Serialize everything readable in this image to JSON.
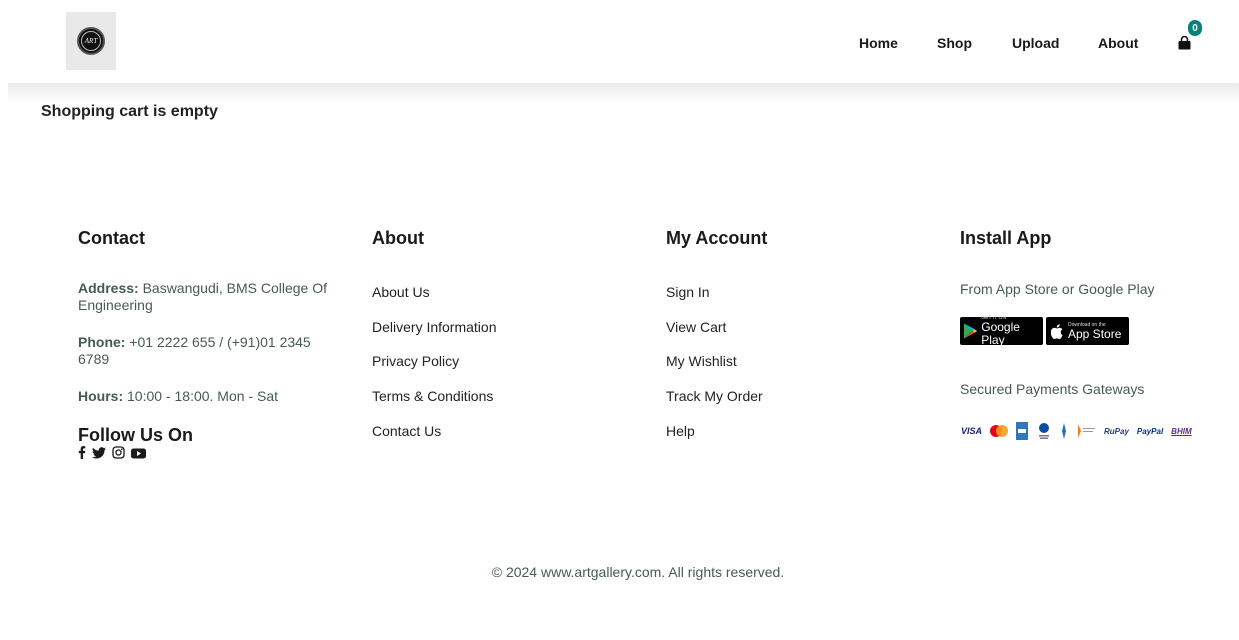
{
  "header": {
    "logo_text": "ART",
    "nav": [
      {
        "label": "Home"
      },
      {
        "label": "Shop"
      },
      {
        "label": "Upload"
      },
      {
        "label": "About"
      }
    ],
    "cart_count": "0"
  },
  "main": {
    "message": "Shopping cart is empty"
  },
  "footer": {
    "contact": {
      "title": "Contact",
      "address_label": "Address:",
      "address_value": " Baswangudi, BMS College Of Engineering",
      "phone_label": "Phone:",
      "phone_value": " +01 2222 655 / (+91)01 2345 6789",
      "hours_label": "Hours:",
      "hours_value": " 10:00 - 18:00. Mon - Sat",
      "follow_title": "Follow Us On",
      "socials": [
        "facebook-icon",
        "twitter-icon",
        "instagram-icon",
        "youtube-icon"
      ]
    },
    "about": {
      "title": "About",
      "links": [
        "About Us",
        "Delivery Information",
        "Privacy Policy",
        "Terms & Conditions",
        "Contact Us"
      ]
    },
    "account": {
      "title": "My Account",
      "links": [
        "Sign In",
        "View Cart",
        "My Wishlist",
        "Track My Order",
        "Help"
      ]
    },
    "app": {
      "title": "Install App",
      "subtitle": "From App Store or Google Play",
      "google_play_small": "GET IT ON",
      "google_play_big": "Google Play",
      "app_store_small": "Download on the",
      "app_store_big": "App Store",
      "payments_title": "Secured Payments Gateways",
      "payments": [
        "VISA",
        "Mastercard",
        "Amex",
        "Diners",
        "Net Banking",
        "UPI",
        "RuPay",
        "PayPal",
        "BHIM"
      ]
    },
    "copyright": "© 2024 www.artgallery.com. All rights reserved."
  },
  "colors": {
    "accent": "#088178",
    "text_muted": "#465b52",
    "text_dark": "#1a1a1a"
  }
}
